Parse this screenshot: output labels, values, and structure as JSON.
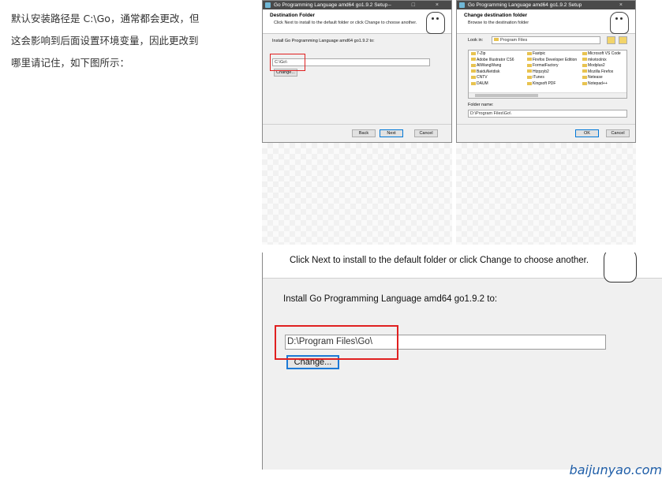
{
  "article": {
    "lines": [
      "默认安装路径是 C:\\Go，通常都会更改，但",
      "这会影响到后面设置环境变量，因此更改到",
      "哪里请记住，如下图所示："
    ]
  },
  "win1": {
    "title": "Go Programming Language amd64 go1.9.2 Setup",
    "controls": "– □ ×",
    "header_title": "Destination Folder",
    "header_sub": "Click Next to install to the default folder or click Change to choose another.",
    "install_label": "Install Go Programming Language amd64 go1.9.2 to:",
    "path_value": "C:\\Go\\",
    "change_label": "Change...",
    "back_label": "Back",
    "next_label": "Next",
    "cancel_label": "Cancel"
  },
  "win2": {
    "title": "Go Programming Language amd64 go1.9.2 Setup",
    "controls": "×",
    "header_title": "Change destination folder",
    "header_sub": "Browse to the destination folder",
    "look_in_label": "Look in:",
    "look_in_value": "Program Files",
    "folders_col1": [
      "7-Zip",
      "Adobe Illustrator CS6",
      "AliWangWang",
      "BaiduNetdisk",
      "CNTV",
      "DAUM"
    ],
    "folders_col2": [
      "Fastpic",
      "Firefox Developer Edition",
      "FormatFactory",
      "Htzpzyb2",
      "iTunes",
      "Kingsoft PDF"
    ],
    "folders_col3": [
      "Microsoft VS Code",
      "mkvtoolnix",
      "Modplus2",
      "Mozilla Firefox",
      "Netease",
      "Notepad++"
    ],
    "folder_name_label": "Folder name:",
    "folder_name_value": "D:\\Program Files\\Go\\",
    "ok_label": "OK",
    "cancel_label": "Cancel"
  },
  "zoom": {
    "header_sub": "Click Next to install to the default folder or click Change to choose another.",
    "install_label": "Install Go Programming Language amd64 go1.9.2 to:",
    "path_value": "D:\\Program Files\\Go\\",
    "change_label": "Change..."
  },
  "watermark": "baijunyao.com"
}
